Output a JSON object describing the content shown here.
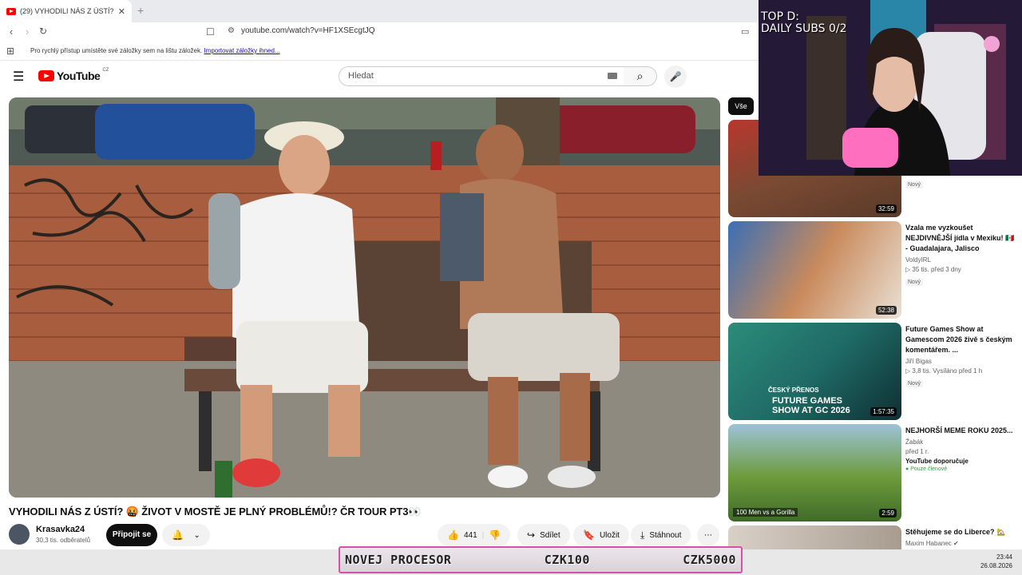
{
  "browser": {
    "tab_title": "(29) VYHODILI NÁS Z ÚSTÍ? 🤬",
    "new_tab": "+",
    "url": "youtube.com/watch?v=HF1XSEcgtJQ",
    "bookmarks_text": "Pro rychlý přístup umístěte své záložky sem na lištu záložek.",
    "bookmarks_link": "Importovat záložky ihned..."
  },
  "youtube": {
    "logo_text": "YouTube",
    "logo_region": "CZ",
    "search_placeholder": "Hledat"
  },
  "video": {
    "title": "VYHODILI NÁS Z ÚSTÍ? 🤬 ŽIVOT V MOSTĚ JE PLNÝ PROBLÉMŮ!? ČR TOUR PT3👀",
    "channel": "Krasavka24",
    "subscribers": "30,3 tis. odběratelů",
    "join_label": "Připojit se",
    "likes": "441",
    "share_label": "Sdílet",
    "save_label": "Uložit",
    "download_label": "Stáhnout"
  },
  "sidebar": {
    "filter_all": "Vše",
    "recommendations": [
      {
        "title": "",
        "channel": "",
        "meta": "",
        "badge": "Nový",
        "duration": "32:59",
        "colors": [
          "#b8372e",
          "#5a3a2a"
        ]
      },
      {
        "title": "Vzala me vyzkoušet NEJDIVNĚJŠÍ jídla v Mexiku! 🇲🇽 - Guadalajara, Jalisco",
        "channel": "VoldyIRL",
        "views": "35 tis.",
        "age": "před 3 dny",
        "badge": "Nový",
        "duration": "52:38",
        "colors": [
          "#3a6fb5",
          "#c98a5c"
        ]
      },
      {
        "title": "Future Games Show at Gamescom 2026 živě s českým komentářem. ...",
        "channel": "Jiří Bigas",
        "views": "3,8 tis.",
        "age": "Vysíláno před 1 h",
        "badge": "Nový",
        "duration": "1:57:35",
        "thumb_text": "ČESKÝ PŘENOS",
        "thumb_big": "FUTURE GAMES SHOW AT GC 2026",
        "colors": [
          "#1f6b66",
          "#0f2f33"
        ]
      },
      {
        "title": "NEJHORŠÍ MEME ROKU 2025...",
        "channel": "Žabák",
        "views": "před 1 r.",
        "age": "",
        "badge": "YouTube doporučuje",
        "members": "Pouze členové",
        "duration": "2:59",
        "thumb_text": "100 Men vs a Gorilla",
        "colors": [
          "#6d9a3a",
          "#3f6b2a"
        ]
      },
      {
        "title": "Stěhujeme se do Liberce? 🏡",
        "channel": "Maxim Habanec ✔",
        "views": "",
        "age": "",
        "badge": "",
        "duration": "",
        "colors": [
          "#d9d0c8",
          "#a89c90"
        ]
      }
    ]
  },
  "stream": {
    "cam_text_line1": "TOP D:",
    "cam_text_line2": "DAILY SUBS 0/2",
    "donate_left": "NOVEJ PROCESOR",
    "donate_mid": "CZK100",
    "donate_right": "CZK5000",
    "time": "23:44",
    "date": "26.08.2026"
  }
}
